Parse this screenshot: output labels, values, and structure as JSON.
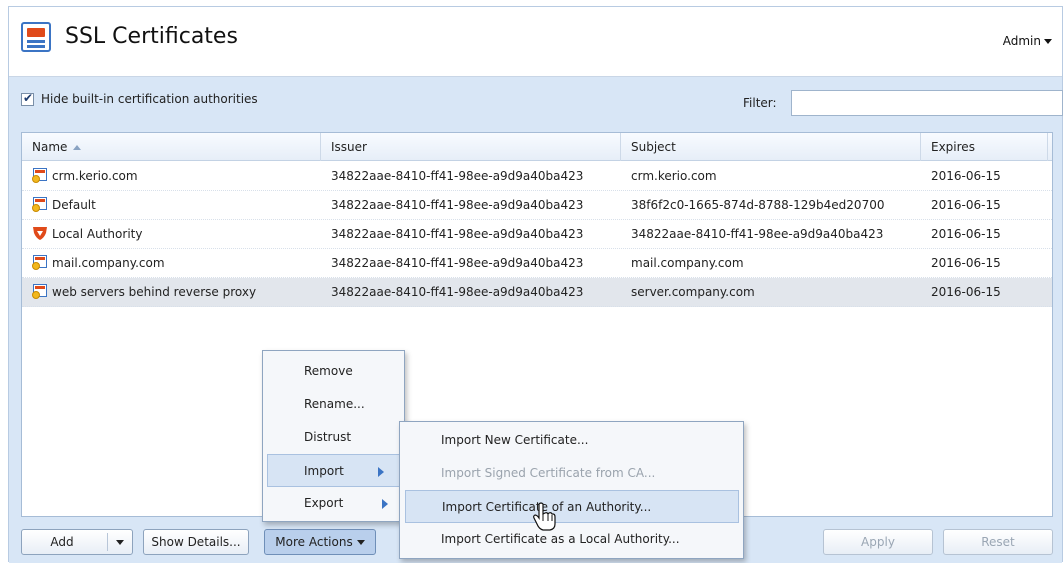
{
  "header": {
    "title": "SSL Certificates",
    "user_menu": "Admin"
  },
  "toolbar": {
    "hide_builtin_label": "Hide built-in certification authorities",
    "hide_builtin_checked": true,
    "filter_label": "Filter:",
    "filter_value": ""
  },
  "grid": {
    "columns": [
      "Name",
      "Issuer",
      "Subject",
      "Expires"
    ],
    "rows": [
      {
        "icon": "certificate-icon",
        "name": "crm.kerio.com",
        "issuer": "34822aae-8410-ff41-98ee-a9d9a40ba423",
        "subject": "crm.kerio.com",
        "expires": "2016-06-15"
      },
      {
        "icon": "certificate-icon",
        "name": "Default",
        "issuer": "34822aae-8410-ff41-98ee-a9d9a40ba423",
        "subject": "38f6f2c0-1665-874d-8788-129b4ed20700",
        "expires": "2016-06-15"
      },
      {
        "icon": "shield-icon",
        "name": "Local Authority",
        "issuer": "34822aae-8410-ff41-98ee-a9d9a40ba423",
        "subject": "34822aae-8410-ff41-98ee-a9d9a40ba423",
        "expires": "2016-06-15"
      },
      {
        "icon": "certificate-icon",
        "name": "mail.company.com",
        "issuer": "34822aae-8410-ff41-98ee-a9d9a40ba423",
        "subject": "mail.company.com",
        "expires": "2016-06-15"
      },
      {
        "icon": "certificate-icon",
        "name": "web servers behind reverse proxy",
        "issuer": "34822aae-8410-ff41-98ee-a9d9a40ba423",
        "subject": "server.company.com",
        "expires": "2016-06-15",
        "selected": true
      }
    ]
  },
  "buttons": {
    "add": "Add",
    "show_details": "Show Details...",
    "more_actions": "More Actions",
    "apply": "Apply",
    "reset": "Reset"
  },
  "more_actions_menu": {
    "items": [
      "Remove",
      "Rename...",
      "Distrust",
      "Import",
      "Export"
    ]
  },
  "import_submenu": {
    "items": [
      "Import New Certificate...",
      "Import Signed Certificate from CA...",
      "Import Certificate of an Authority...",
      "Import Certificate as a Local Authority..."
    ]
  },
  "colors": {
    "accent": "#3b74c4",
    "brand_red": "#e04a1a",
    "panel_bg": "#d8e6f6"
  }
}
